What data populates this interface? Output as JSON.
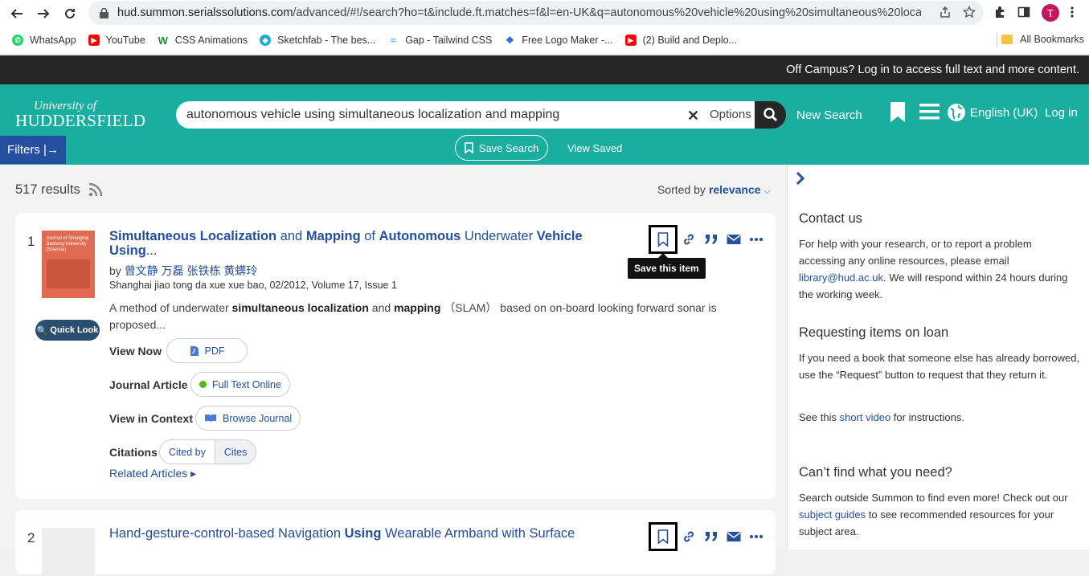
{
  "browser": {
    "url_host": "hud.summon.serialssolutions.com",
    "url_path": "/advanced/#!/search?ho=t&include.ft.matches=f&l=en-UK&q=autonomous%20vehicle%20using%20simultaneous%20localizatio...",
    "avatar_letter": "T",
    "bookmarks": [
      {
        "label": "WhatsApp",
        "color": "#25d366"
      },
      {
        "label": "YouTube",
        "color": "#ff0000"
      },
      {
        "label": "CSS Animations",
        "color": "#1f8a3a"
      },
      {
        "label": "Sketchfab - The bes...",
        "color": "#1caad9"
      },
      {
        "label": "Gap - Tailwind CSS",
        "color": "#38bdf8"
      },
      {
        "label": "Free Logo Maker -...",
        "color": "#2d6cdf"
      },
      {
        "label": "(2) Build and Deplo...",
        "color": "#ff0000"
      }
    ],
    "all_bookmarks": "All Bookmarks"
  },
  "offcampus": "Off Campus? Log in to access full text and more content.",
  "header": {
    "logo_line1": "University of",
    "logo_line2": "HUDDERSFIELD",
    "query": "autonomous vehicle using simultaneous localization and mapping",
    "options": "Options",
    "new_search": "New Search",
    "language": "English (UK)",
    "login": "Log in",
    "filters": "Filters |→",
    "save_search": "Save Search",
    "view_saved": "View Saved"
  },
  "results": {
    "count": "517 results",
    "sorted_by": "Sorted by",
    "sort_value": "relevance"
  },
  "items": [
    {
      "num": "1",
      "title_parts": [
        "Simultaneous Localization",
        " and ",
        "Mapping",
        " of ",
        "Autonomous",
        " Underwater ",
        "Vehicle",
        " ",
        "Using",
        "..."
      ],
      "by": "by ",
      "authors": "曾文静 万磊 张铁栋 黄蠎玲",
      "pubinfo": "Shanghai jiao tong da xue xue bao, 02/2012, Volume 17, Issue 1",
      "abstract_parts": [
        "A method of underwater ",
        "simultaneous localization",
        " and ",
        "mapping",
        " （SLAM） based on on-board looking forward sonar is proposed..."
      ],
      "quick_look": "Quick Look",
      "view_now": "View Now",
      "pdf": "PDF",
      "type": "Journal Article",
      "full_text": "Full Text Online",
      "view_in_context": "View in Context",
      "browse_journal": "Browse Journal",
      "citations": "Citations",
      "cited_by": "Cited by",
      "cites": "Cites",
      "related": "Related Articles ▸",
      "tooltip": "Save this item",
      "cover_text": "Journal of Shanghai Jiaotong University (Science)"
    },
    {
      "num": "2",
      "title_parts": [
        "Hand-gesture-control-based Navigation ",
        "Using",
        " Wearable Armband with Surface"
      ]
    }
  ],
  "sidebar": {
    "contact_h": "Contact us",
    "contact_p1": "For help with your research, or to report a problem accessing any online resources, please email ",
    "contact_email": "library@hud.ac.uk",
    "contact_p2": ". We will respond within 24 hours during the working week.",
    "loan_h": "Requesting items on loan",
    "loan_p": "If you need a book that someone else has already borrowed, use the “Request” button to request that they return it.",
    "video_p1": "See this ",
    "video_link": "short video",
    "video_p2": " for instructions.",
    "cant_h": "Can’t find what you need?",
    "cant_p1": "Search outside Summon to find even more! Check out our ",
    "cant_link": "subject guides",
    "cant_p2": " to see recommended resources for your subject area."
  }
}
